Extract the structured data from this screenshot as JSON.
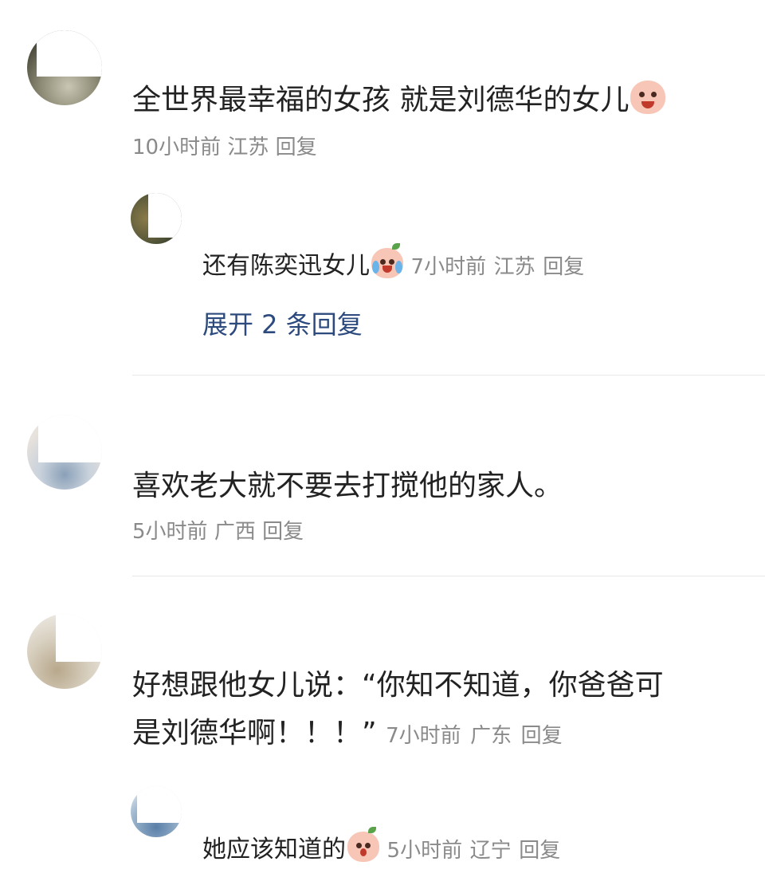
{
  "comments": [
    {
      "text": "全世界最幸福的女孩 就是刘德华的女儿",
      "emoji": "laughing-pig-emoji",
      "time": "10小时前",
      "location": "江苏",
      "reply_label": "回复",
      "replies": [
        {
          "text": "还有陈奕迅女儿",
          "emoji": "crying-laughing-peach-emoji",
          "time": "7小时前",
          "location": "江苏",
          "reply_label": "回复"
        }
      ],
      "expand_label": "展开 2 条回复"
    },
    {
      "text": "喜欢老大就不要去打搅他的家人。",
      "time": "5小时前",
      "location": "广西",
      "reply_label": "回复"
    },
    {
      "text_line1": "好想跟他女儿说：“你知不知道，你爸爸可",
      "text_line2": "是刘德华啊！！！”",
      "time": "7小时前",
      "location": "广东",
      "reply_label": "回复",
      "replies": [
        {
          "text": "她应该知道的",
          "emoji": "surprised-peach-emoji",
          "time": "5小时前",
          "location": "辽宁",
          "reply_label": "回复"
        }
      ]
    }
  ],
  "colors": {
    "text": "#222222",
    "meta": "#8a8a8a",
    "link": "#2c4a7e",
    "divider": "#e8e8e8"
  }
}
